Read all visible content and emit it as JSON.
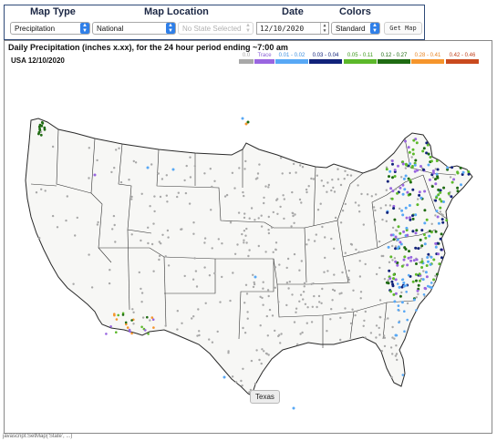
{
  "header": {
    "col_map_type": "Map Type",
    "col_map_location": "Map Location",
    "col_date": "Date",
    "col_colors": "Colors"
  },
  "controls": {
    "map_type": "Precipitation",
    "location": "National",
    "state": "No State Selected",
    "date": "12/10/2020",
    "colors": "Standard",
    "get_map_label": "Get Map"
  },
  "map": {
    "title": "Daily Precipitation (inches  x.xx),  for the 24 hour period ending ~7:00 am",
    "subtitle": "USA 12/10/2020",
    "tooltip": "Texas"
  },
  "legend": [
    {
      "label": "0.0",
      "color": "#a8a8a8",
      "label_color": "#a8a8a8"
    },
    {
      "label": "Trace",
      "color": "#9966e0",
      "label_color": "#8a5fd6"
    },
    {
      "label": "0.01 - 0.02",
      "color": "#58a8f5",
      "label_color": "#3d8fe0"
    },
    {
      "label": "0.03 - 0.04",
      "color": "#11227a",
      "label_color": "#11227a"
    },
    {
      "label": "0.05 - 0.11",
      "color": "#5cb82a",
      "label_color": "#3c9a1a"
    },
    {
      "label": "0.12 - 0.27",
      "color": "#1f6b12",
      "label_color": "#1f6b12"
    },
    {
      "label": "0.28 - 0.41",
      "color": "#f5952c",
      "label_color": "#e8821d"
    },
    {
      "label": "0.42 - 0.46",
      "color": "#c94a1e",
      "label_color": "#c0401a"
    }
  ],
  "status_text": "javascript:SetMap('State', ...)",
  "icons": {
    "select_arrow": "chevron-updown-icon",
    "date_spinner": "spinner-icon"
  }
}
